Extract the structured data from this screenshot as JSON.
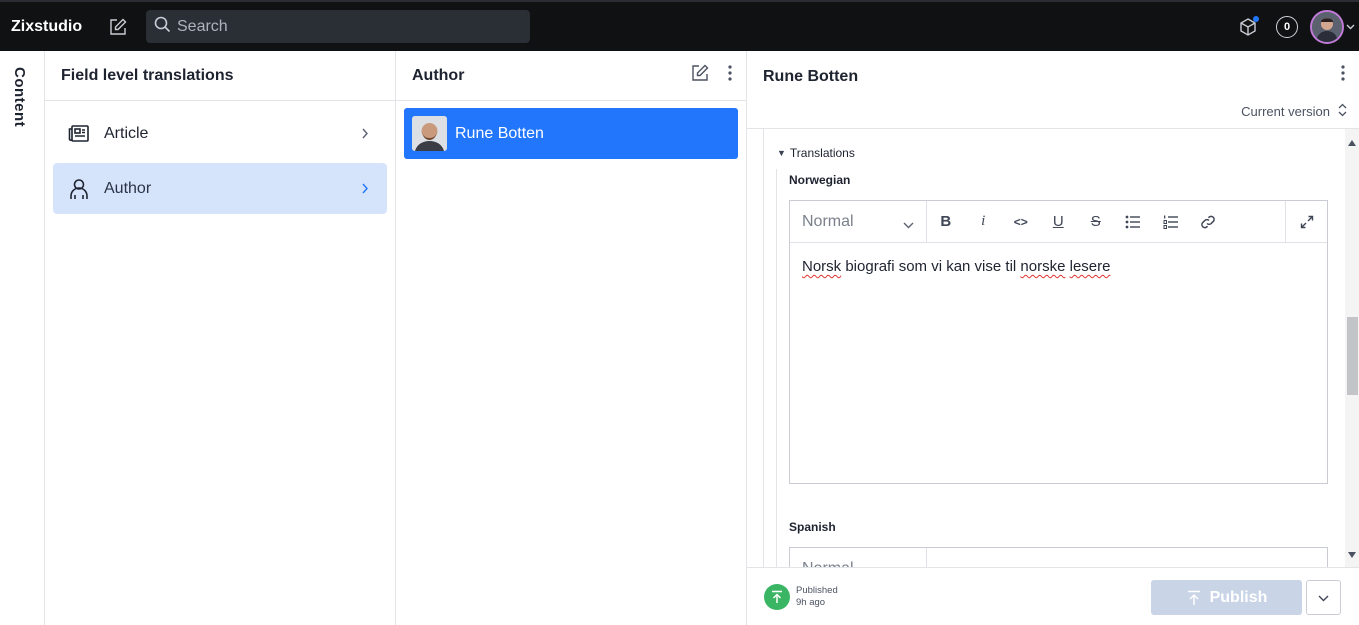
{
  "app": {
    "brand": "Zixstudio"
  },
  "topbar": {
    "search_placeholder": "Search",
    "notification_count": "0"
  },
  "rail": {
    "label": "Content"
  },
  "pane1": {
    "title": "Field level translations",
    "items": [
      {
        "label": "Article",
        "icon": "newspaper-icon",
        "active": false
      },
      {
        "label": "Author",
        "icon": "user-icon",
        "active": true
      }
    ]
  },
  "pane2": {
    "title": "Author",
    "documents": [
      {
        "label": "Rune Botten",
        "selected": true
      }
    ]
  },
  "pane3": {
    "title": "Rune Botten",
    "version_label": "Current version",
    "translations_label": "Translations",
    "fields": [
      {
        "label": "Norwegian",
        "style": "Normal",
        "text_parts": [
          "Norsk",
          " biografi som vi kan vise til ",
          "norske",
          " ",
          "lesere"
        ]
      },
      {
        "label": "Spanish",
        "style": "Normal"
      }
    ],
    "toolbar_buttons": [
      "B",
      "i",
      "<>",
      "U",
      "S"
    ],
    "status": {
      "state": "Published",
      "time": "9h ago"
    },
    "publish_label": "Publish"
  },
  "colors": {
    "accent": "#2276fc",
    "topbar": "#101112",
    "published": "#3ab564",
    "selected_bg": "#d6e4fb"
  }
}
